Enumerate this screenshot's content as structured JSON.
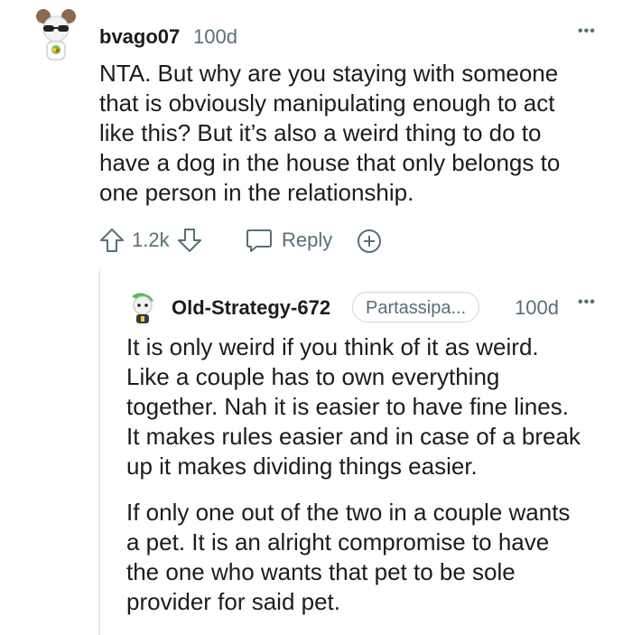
{
  "comment": {
    "username": "bvago07",
    "age": "100d",
    "more_label": "•••",
    "body": [
      "NTA. But why are you staying with someone",
      "that is obviously manipulating enough to act",
      "like this? But it’s also a weird thing to do to",
      "have a dog in the house that only belongs to",
      "one person in the relationship."
    ],
    "score": "1.2k",
    "reply_label": "Reply"
  },
  "reply": {
    "username": "Old-Strategy-672",
    "flair": "Partassipa...",
    "age": "100d",
    "more_label": "•••",
    "paragraph1": [
      "It is only weird if you think of it as weird.",
      "Like a couple has to own everything",
      "together. Nah it is easier to have fine lines.",
      "It makes rules easier and in case of a break",
      "up it makes dividing things easier."
    ],
    "paragraph2": [
      "If only one out of the two in a couple wants",
      "a pet. It is an alright compromise to have",
      "the one who wants that pet to be sole",
      "provider for said pet."
    ]
  },
  "colors": {
    "text": "#1c1c1c",
    "muted": "#576f76",
    "thread": "#e5e9eb",
    "accent": "#ff4500"
  },
  "icons": [
    "upvote-icon",
    "downvote-icon",
    "reply-icon",
    "award-icon"
  ]
}
